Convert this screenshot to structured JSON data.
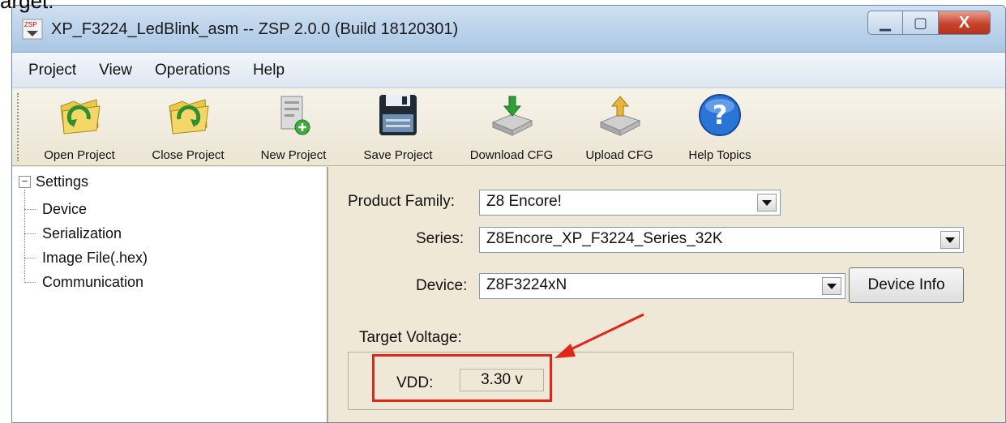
{
  "snippet_text": "arget:",
  "window": {
    "title": "XP_F3224_LedBlink_asm -- ZSP 2.0.0 (Build 18120301)",
    "minimize_glyph": "▁",
    "maximize_glyph": "▢",
    "close_glyph": "X"
  },
  "menu": {
    "items": [
      "Project",
      "View",
      "Operations",
      "Help"
    ]
  },
  "toolbar": {
    "buttons": [
      {
        "label": "Open Project",
        "icon": "folder-open-icon"
      },
      {
        "label": "Close Project",
        "icon": "folder-close-icon"
      },
      {
        "label": "New Project",
        "icon": "new-document-icon"
      },
      {
        "label": "Save Project",
        "icon": "floppy-disk-icon"
      },
      {
        "label": "Download CFG",
        "icon": "download-cfg-icon"
      },
      {
        "label": "Upload CFG",
        "icon": "upload-cfg-icon"
      },
      {
        "label": "Help Topics",
        "icon": "help-icon"
      }
    ]
  },
  "tree": {
    "expander_glyph": "−",
    "root": "Settings",
    "children": [
      "Device",
      "Serialization",
      "Image File(.hex)",
      "Communication"
    ]
  },
  "form": {
    "product_family_label": "Product Family:",
    "product_family_value": "Z8 Encore!",
    "series_label": "Series:",
    "series_value": "Z8Encore_XP_F3224_Series_32K",
    "device_label": "Device:",
    "device_value": "Z8F3224xN",
    "device_info_button": "Device Info",
    "target_voltage_label": "Target Voltage:",
    "vdd_label": "VDD:",
    "vdd_value": "3.30 v"
  },
  "colors": {
    "annotation": "#e0251a",
    "content_bg": "#efe8d6",
    "titlebar": "#b9d1ea"
  }
}
